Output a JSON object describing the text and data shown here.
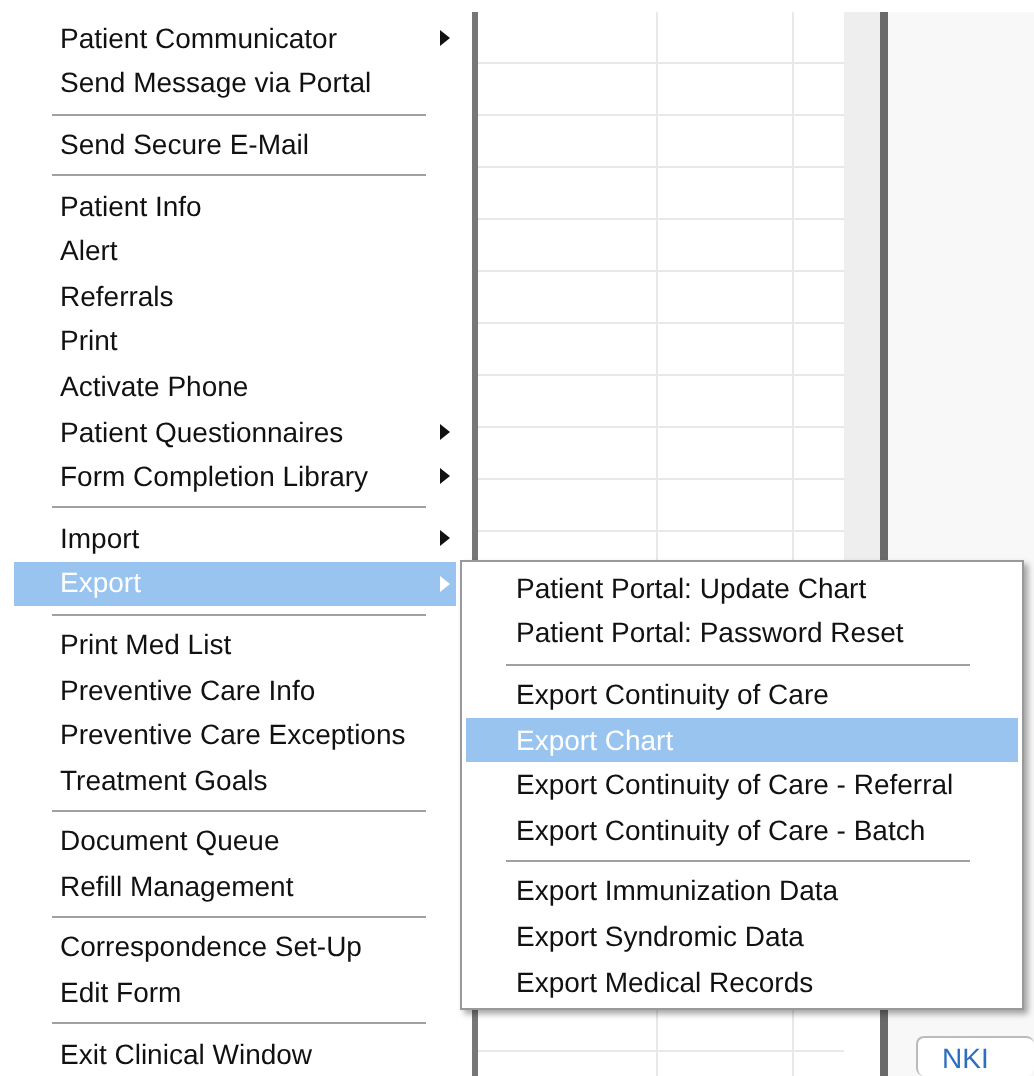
{
  "context_menu": {
    "items": [
      {
        "kind": "submenu",
        "label": "Patient Communicator",
        "selected": false
      },
      {
        "kind": "item",
        "label": "Send Message via Portal",
        "selected": false
      },
      {
        "kind": "separator"
      },
      {
        "kind": "item",
        "label": "Send Secure E-Mail",
        "selected": false
      },
      {
        "kind": "separator"
      },
      {
        "kind": "item",
        "label": "Patient Info",
        "selected": false
      },
      {
        "kind": "item",
        "label": "Alert",
        "selected": false
      },
      {
        "kind": "item",
        "label": "Referrals",
        "selected": false
      },
      {
        "kind": "item",
        "label": "Print",
        "selected": false
      },
      {
        "kind": "item",
        "label": "Activate Phone",
        "selected": false
      },
      {
        "kind": "submenu",
        "label": "Patient Questionnaires",
        "selected": false
      },
      {
        "kind": "submenu",
        "label": "Form Completion Library",
        "selected": false
      },
      {
        "kind": "separator"
      },
      {
        "kind": "submenu",
        "label": "Import",
        "selected": false
      },
      {
        "kind": "submenu",
        "label": "Export",
        "selected": true
      },
      {
        "kind": "separator"
      },
      {
        "kind": "item",
        "label": "Print Med List",
        "selected": false
      },
      {
        "kind": "item",
        "label": "Preventive Care Info",
        "selected": false
      },
      {
        "kind": "item",
        "label": "Preventive Care Exceptions",
        "selected": false
      },
      {
        "kind": "item",
        "label": "Treatment Goals",
        "selected": false
      },
      {
        "kind": "separator"
      },
      {
        "kind": "item",
        "label": "Document Queue",
        "selected": false
      },
      {
        "kind": "item",
        "label": "Refill Management",
        "selected": false
      },
      {
        "kind": "separator"
      },
      {
        "kind": "item",
        "label": "Correspondence Set-Up",
        "selected": false
      },
      {
        "kind": "item",
        "label": "Edit Form",
        "selected": false
      },
      {
        "kind": "separator"
      },
      {
        "kind": "item",
        "label": "Exit Clinical Window",
        "selected": false
      }
    ]
  },
  "export_submenu": {
    "items": [
      {
        "kind": "item",
        "label": "Patient Portal: Update Chart",
        "selected": false
      },
      {
        "kind": "item",
        "label": "Patient Portal: Password Reset",
        "selected": false
      },
      {
        "kind": "separator"
      },
      {
        "kind": "item",
        "label": "Export Continuity of Care",
        "selected": false
      },
      {
        "kind": "item",
        "label": "Export Chart",
        "selected": true
      },
      {
        "kind": "item",
        "label": "Export Continuity of Care - Referral",
        "selected": false
      },
      {
        "kind": "item",
        "label": "Export Continuity of Care - Batch",
        "selected": false
      },
      {
        "kind": "separator"
      },
      {
        "kind": "item",
        "label": "Export Immunization Data",
        "selected": false
      },
      {
        "kind": "item",
        "label": "Export Syndromic Data",
        "selected": false
      },
      {
        "kind": "item",
        "label": "Export Medical Records",
        "selected": false
      }
    ]
  },
  "background_button": {
    "label": "NKI"
  }
}
